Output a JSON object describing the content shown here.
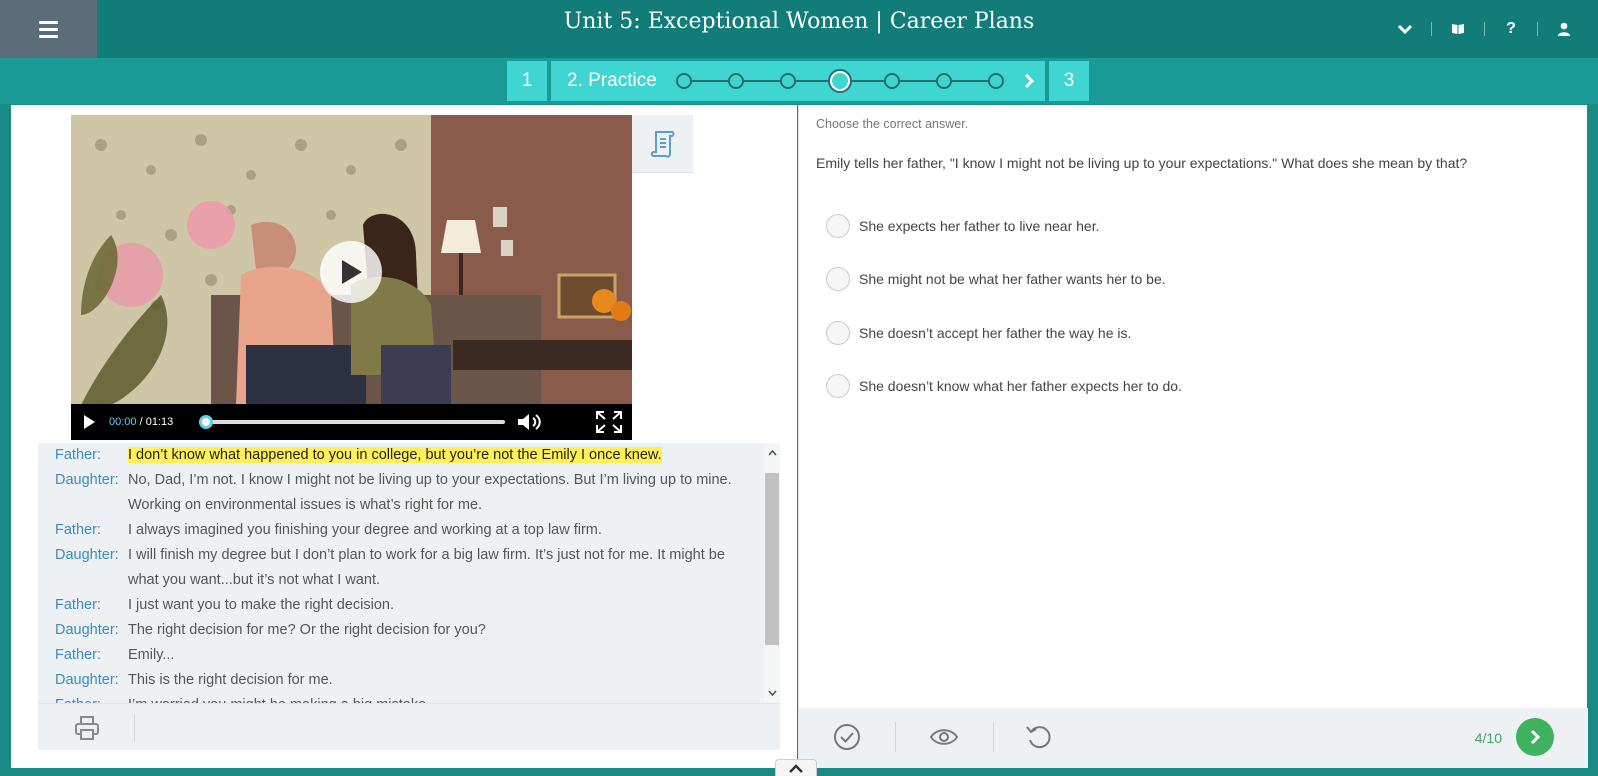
{
  "header": {
    "title": "Unit 5: Exceptional Women | Career Plans",
    "icons": [
      "menu-icon",
      "chevron-down-icon",
      "book-icon",
      "help-icon",
      "user-icon"
    ],
    "help_label": "?"
  },
  "stepper": {
    "step1": "1",
    "step2": "2. Practice",
    "step3": "3",
    "dot_count": 7,
    "current_dot": 4
  },
  "video": {
    "current_time": "00:00",
    "duration": "/ 01:13",
    "progress": 0
  },
  "transcript": [
    {
      "speaker": "Father:",
      "text": "I don’t know what happened to you in college, but you’re not the Emily I once knew.",
      "highlight": true
    },
    {
      "speaker": "Daughter:",
      "text": "No, Dad, I’m not. I know I might not be living up to your expectations. But I’m living up to mine. Working on environmental issues is what’s right for me."
    },
    {
      "speaker": "Father:",
      "text": "I always imagined you finishing your degree and working at a top law firm."
    },
    {
      "speaker": "Daughter:",
      "text": "I will finish my degree but I don’t plan to work for a big law firm. It’s just not for me. It might be what you want...but it’s not what I want."
    },
    {
      "speaker": "Father:",
      "text": "I just want you to make the right decision."
    },
    {
      "speaker": "Daughter:",
      "text": "The right decision for me? Or the right decision for you?"
    },
    {
      "speaker": "Father:",
      "text": "Emily..."
    },
    {
      "speaker": "Daughter:",
      "text": "This is the right decision for me."
    },
    {
      "speaker": "Father:",
      "text": "I’m worried you might be making a big mistake."
    }
  ],
  "exercise": {
    "instruction": "Choose the correct answer.",
    "question": "Emily tells her father, \"I know I might not be living up to your expectations.\" What does she mean by that?",
    "options": [
      "She expects her father to live near her.",
      "She might not be what her father wants her to be.",
      "She doesn’t accept her father the way he is.",
      "She doesn’t know what her father expects her to do."
    ]
  },
  "footer": {
    "counter": "4/10",
    "icons": [
      "check-icon",
      "eye-icon",
      "undo-icon",
      "next-arrow-icon"
    ]
  },
  "colors": {
    "header": "#127c78",
    "stepper_bg": "#199a94",
    "step_accent": "#3fd6d1",
    "speaker": "#3a8bc1",
    "highlight": "#fff05a",
    "counter": "#3ea55e"
  }
}
